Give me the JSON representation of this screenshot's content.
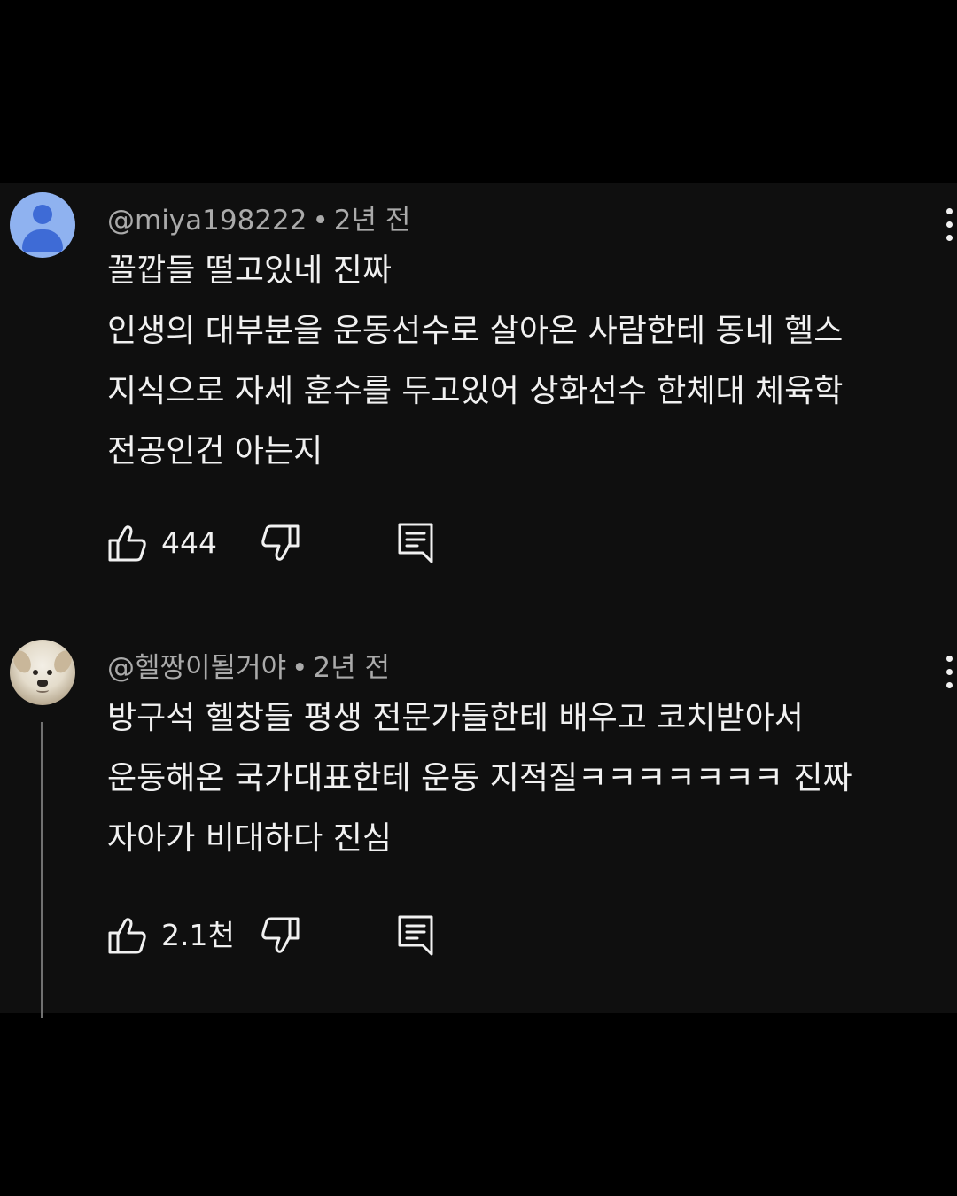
{
  "comments": [
    {
      "author": "@miya198222",
      "time": "2년 전",
      "lines": [
        "꼴깝들 떨고있네 진짜",
        "인생의 대부분을 운동선수로 살아온 사람한테 동네 헬스",
        "지식으로 자세 훈수를 두고있어 상화선수 한체대 체육학",
        "전공인건 아는지"
      ],
      "likes": "444",
      "avatar": "default-person-avatar"
    },
    {
      "author": "@헬짱이될거야",
      "time": "2년 전",
      "lines": [
        "방구석 헬창들 평생 전문가들한테 배우고 코치받아서",
        "운동해온 국가대표한테 운동 지적질ㅋㅋㅋㅋㅋㅋㅋ 진짜",
        "자아가 비대하다 진심"
      ],
      "likes": "2.1천",
      "avatar": "puppy-photo-avatar"
    }
  ],
  "separator": "•",
  "icons": {
    "like": "thumbs-up-icon",
    "dislike": "thumbs-down-icon",
    "reply": "reply-comment-icon",
    "more": "vertical-ellipsis-icon"
  },
  "colors": {
    "background": "#000000",
    "panel": "#0f0f0f",
    "text": "#f1f1f1",
    "meta": "#aaaaaa",
    "avatar_bg": "#8fb2f0",
    "avatar_fg": "#3e6bd6"
  }
}
